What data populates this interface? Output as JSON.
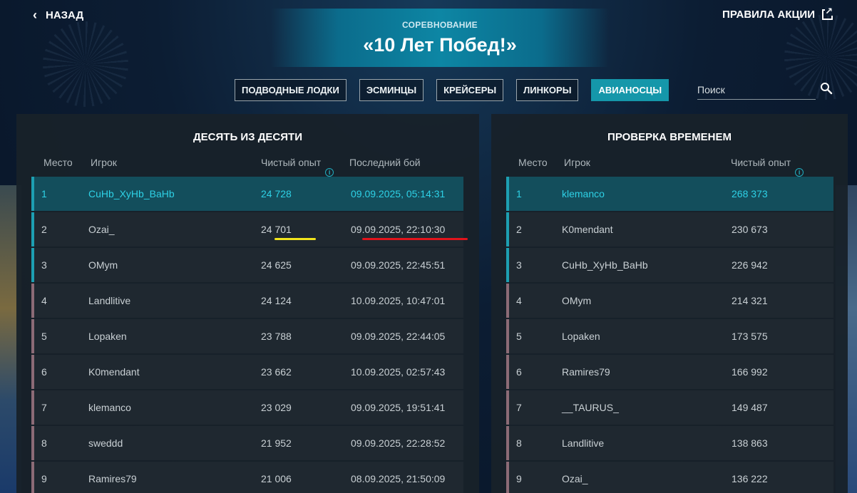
{
  "header": {
    "back_label": "НАЗАД",
    "rules_label": "ПРАВИЛА АКЦИИ",
    "subtitle": "СОРЕВНОВАНИЕ",
    "title": "«10 Лет Побед!»"
  },
  "tabs": [
    {
      "label": "ПОДВОДНЫЕ ЛОДКИ",
      "active": false
    },
    {
      "label": "ЭСМИНЦЫ",
      "active": false
    },
    {
      "label": "КРЕЙСЕРЫ",
      "active": false
    },
    {
      "label": "ЛИНКОРЫ",
      "active": false
    },
    {
      "label": "АВИАНОСЦЫ",
      "active": true
    }
  ],
  "search": {
    "placeholder": "Поиск",
    "value": ""
  },
  "left_table": {
    "title": "ДЕСЯТЬ ИЗ ДЕСЯТИ",
    "columns": [
      "Место",
      "Игрок",
      "Чистый опыт",
      "Последний бой"
    ],
    "rows": [
      {
        "place": "1",
        "player": "CuHb_XyHb_BaHb",
        "xp": "24 728",
        "last": "09.09.2025, 05:14:31"
      },
      {
        "place": "2",
        "player": "Ozai_",
        "xp": "24 701",
        "last": "09.09.2025, 22:10:30"
      },
      {
        "place": "3",
        "player": "OMym",
        "xp": "24 625",
        "last": "09.09.2025, 22:45:51"
      },
      {
        "place": "4",
        "player": "Landlitive",
        "xp": "24 124",
        "last": "10.09.2025, 10:47:01"
      },
      {
        "place": "5",
        "player": "Lopaken",
        "xp": "23 788",
        "last": "09.09.2025, 22:44:05"
      },
      {
        "place": "6",
        "player": "K0mendant",
        "xp": "23 662",
        "last": "10.09.2025, 02:57:43"
      },
      {
        "place": "7",
        "player": "klemanco",
        "xp": "23 029",
        "last": "09.09.2025, 19:51:41"
      },
      {
        "place": "8",
        "player": "sweddd",
        "xp": "21 952",
        "last": "09.09.2025, 22:28:52"
      },
      {
        "place": "9",
        "player": "Ramires79",
        "xp": "21 006",
        "last": "08.09.2025, 21:50:09"
      }
    ]
  },
  "right_table": {
    "title": "ПРОВЕРКА ВРЕМЕНЕМ",
    "columns": [
      "Место",
      "Игрок",
      "Чистый опыт"
    ],
    "rows": [
      {
        "place": "1",
        "player": "klemanco",
        "xp": "268 373"
      },
      {
        "place": "2",
        "player": "K0mendant",
        "xp": "230 673"
      },
      {
        "place": "3",
        "player": "CuHb_XyHb_BaHb",
        "xp": "226 942"
      },
      {
        "place": "4",
        "player": "OMym",
        "xp": "214 321"
      },
      {
        "place": "5",
        "player": "Lopaken",
        "xp": "173 575"
      },
      {
        "place": "6",
        "player": "Ramires79",
        "xp": "166 992"
      },
      {
        "place": "7",
        "player": "__TAURUS_",
        "xp": "149 487"
      },
      {
        "place": "8",
        "player": "Landlitive",
        "xp": "138 863"
      },
      {
        "place": "9",
        "player": "Ozai_",
        "xp": "136 222"
      }
    ]
  },
  "annotations": {
    "underline_yellow_color": "#f2e51c",
    "underline_red_color": "#e1141c"
  },
  "colors": {
    "accent": "#1597aa",
    "top3_marker": "#1d9fb2",
    "other_marker": "#8c6b76",
    "first_row_text": "#2ed1e6"
  }
}
